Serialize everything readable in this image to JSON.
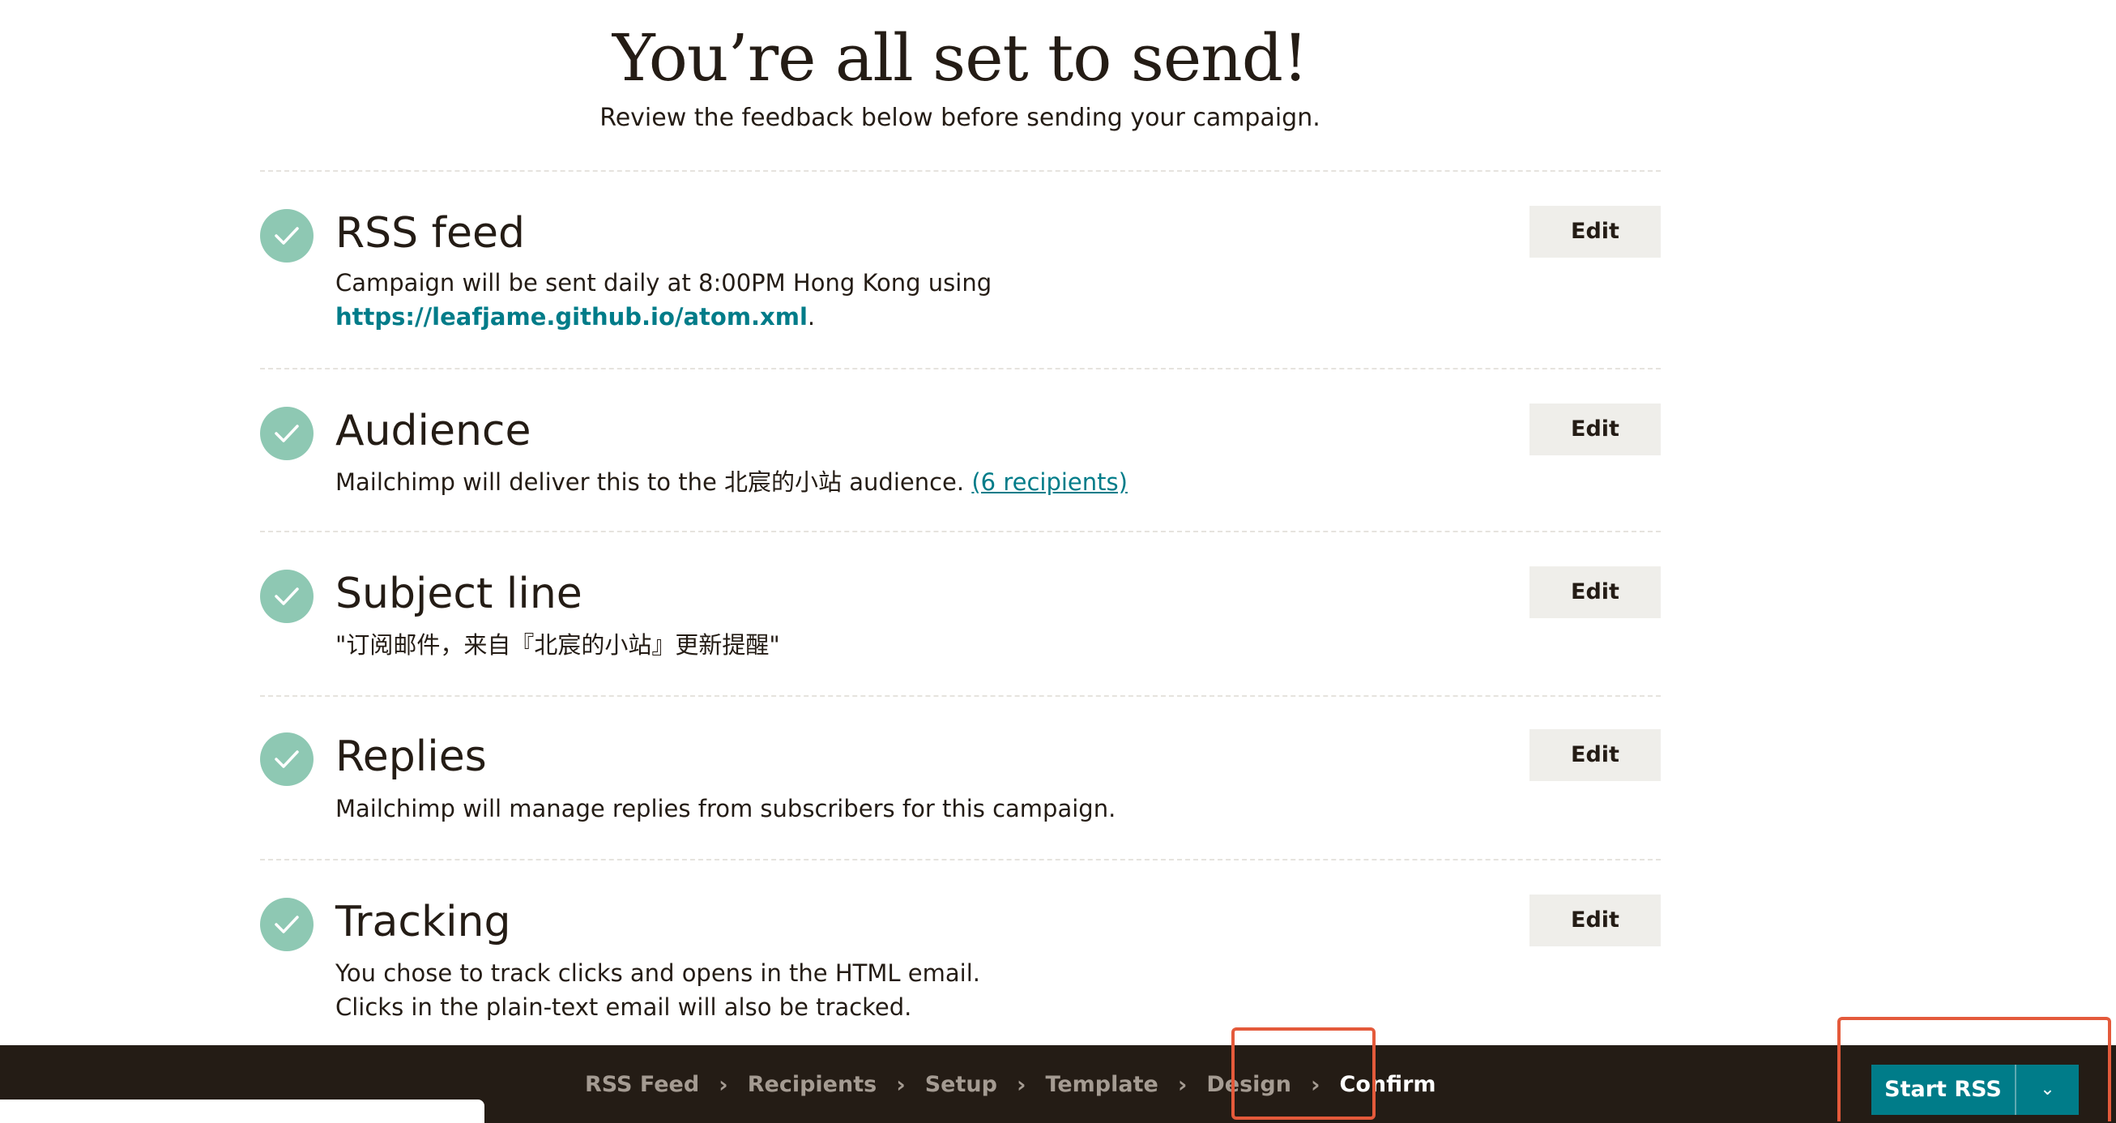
{
  "header": {
    "title": "You’re all set to send!",
    "subtitle": "Review the feedback below before sending your campaign."
  },
  "checklist": [
    {
      "title": "RSS feed",
      "desc_line1": "Campaign will be sent daily at 8:00PM Hong Kong using",
      "link": "https://leafjame.github.io/atom.xml",
      "link_suffix": ".",
      "edit": "Edit"
    },
    {
      "title": "Audience",
      "desc_prefix": "Mailchimp will deliver this to the 北宸的小站 audience. ",
      "link": "(6 recipients)",
      "edit": "Edit"
    },
    {
      "title": "Subject line",
      "desc": "\"订阅邮件，来自『北宸的小站』更新提醒\"",
      "edit": "Edit"
    },
    {
      "title": "Replies",
      "desc": "Mailchimp will manage replies from subscribers for this campaign.",
      "edit": "Edit"
    },
    {
      "title": "Tracking",
      "desc_line1": "You chose to track clicks and opens in the HTML email.",
      "desc_line2": "Clicks in the plain-text email will also be tracked.",
      "edit": "Edit"
    }
  ],
  "footer": {
    "steps": [
      "RSS Feed",
      "Recipients",
      "Setup",
      "Template",
      "Design",
      "Confirm"
    ],
    "chevron": "›",
    "start_label": "Start RSS",
    "toggle_icon": "⌄"
  },
  "colors": {
    "check": "#8ec8b3",
    "accent": "#007c89",
    "footer_bg": "#241c15",
    "annotation": "#e45a3b"
  }
}
